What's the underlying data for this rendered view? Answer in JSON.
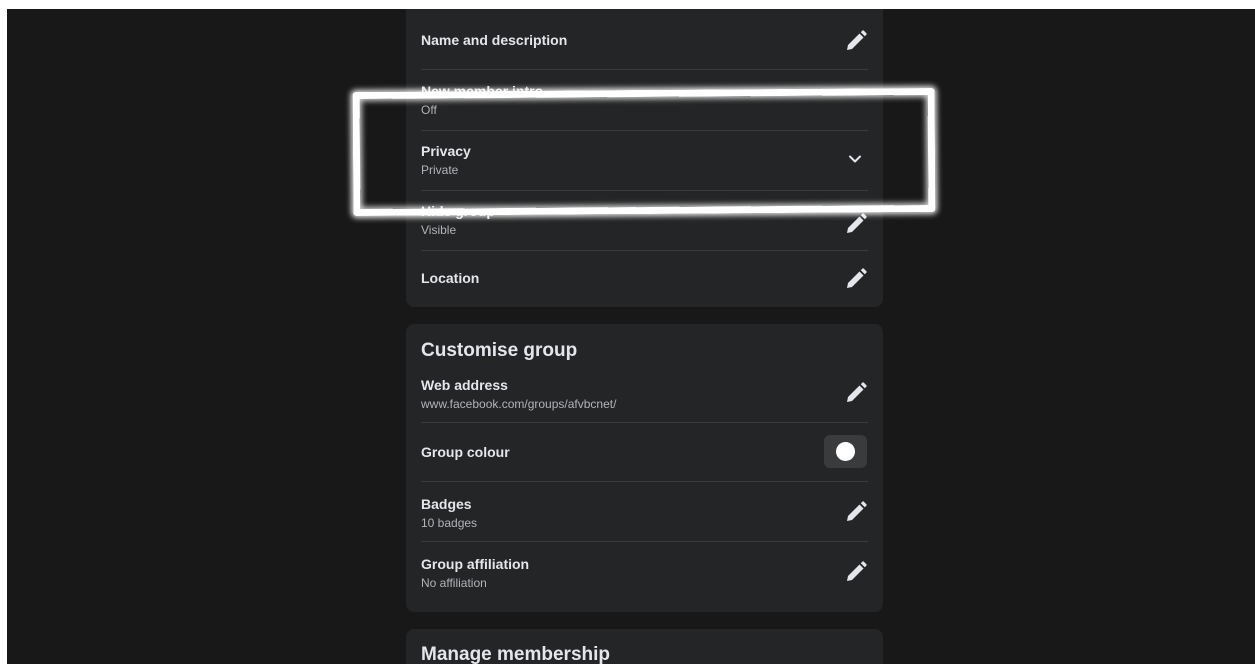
{
  "general_settings": {
    "items": [
      {
        "label": "Name and description",
        "sub": ""
      },
      {
        "label": "New member intro",
        "sub": "Off"
      },
      {
        "label": "Privacy",
        "sub": "Private"
      },
      {
        "label": "Hide group",
        "sub": "Visible"
      },
      {
        "label": "Location",
        "sub": ""
      }
    ]
  },
  "customise_group": {
    "title": "Customise group",
    "items": [
      {
        "label": "Web address",
        "sub": "www.facebook.com/groups/afvbcnet/"
      },
      {
        "label": "Group colour",
        "sub": ""
      },
      {
        "label": "Badges",
        "sub": "10 badges"
      },
      {
        "label": "Group affiliation",
        "sub": "No affiliation"
      }
    ],
    "group_colour": "#ffffff"
  },
  "manage_membership": {
    "title": "Manage membership"
  },
  "icons": {
    "edit": "pencil-icon",
    "expand": "chevron-down-icon"
  },
  "colors": {
    "background": "#181818",
    "card": "#242526",
    "primary_text": "#e4e6eb",
    "secondary_text": "#b0b3b8",
    "annotation": "#ffffff"
  }
}
